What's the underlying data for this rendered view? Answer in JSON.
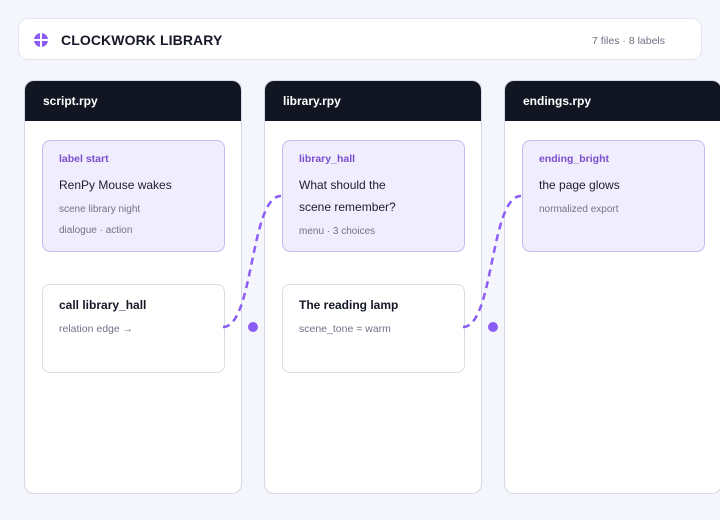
{
  "app": {
    "title": "CLOCKWORK LIBRARY",
    "icon": "plus-circle-icon",
    "stats": "7 files · 8 labels"
  },
  "colors": {
    "accent": "#8b5cf6",
    "header_bg": "#121622",
    "card_primary_bg": "#f0edfd"
  },
  "columns": [
    {
      "name": "script.rpy",
      "card": {
        "tag": "label start",
        "line1": "RenPy Mouse wakes",
        "line2": "",
        "meta1": "scene library night",
        "meta2": "dialogue · action"
      },
      "node": {
        "title": "call library_hall",
        "detail": "relation edge →"
      }
    },
    {
      "name": "library.rpy",
      "card": {
        "tag": "library_hall",
        "line1": "What should the",
        "line2": "scene remember?",
        "meta1": "menu · 3 choices",
        "meta2": ""
      },
      "node": {
        "title": "The reading lamp",
        "detail": "scene_tone = warm"
      }
    },
    {
      "name": "endings.rpy",
      "card": {
        "tag": "ending_bright",
        "line1": "the page glows",
        "line2": "",
        "meta1": "normalized export",
        "meta2": ""
      }
    }
  ]
}
